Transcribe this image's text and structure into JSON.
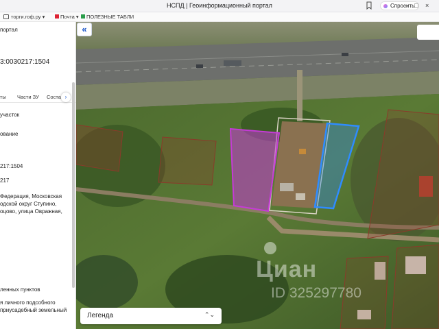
{
  "browser": {
    "title": "НСПД | Геоинформационный портал",
    "ask_label": "Спросить",
    "minimize": "–",
    "restore": "□",
    "close": "×"
  },
  "bookmarks": [
    "торги.гоф.ру",
    "Почта",
    "ПОЛЕЗНЫЕ ТАБЛИ"
  ],
  "panel": {
    "header_fragment": "портал",
    "cadastral_number": "3:0030217:1504",
    "tabs": [
      "ты",
      "Части ЗУ",
      "Соста"
    ],
    "object_type": "участок",
    "naming_fragment": "ование",
    "number_fragment": "217:1504",
    "block_fragment": "217",
    "address_lines": [
      "Федерация, Московская",
      "одской округ Ступино,",
      "оцово, улица Овражная,"
    ],
    "category_fragment": "ленных пунктов",
    "use_lines": [
      "я личного подсобного",
      "приусадебный земельный"
    ]
  },
  "map": {
    "legend_label": "Легенда",
    "watermark_brand": "Циан",
    "watermark_id": "ID 325297780"
  },
  "colors": {
    "parcel_selected": "#c53bd6",
    "parcel_highlight": "#2f8cff",
    "parcel_other": "#8b3a2a",
    "accent": "#1a56c9"
  }
}
